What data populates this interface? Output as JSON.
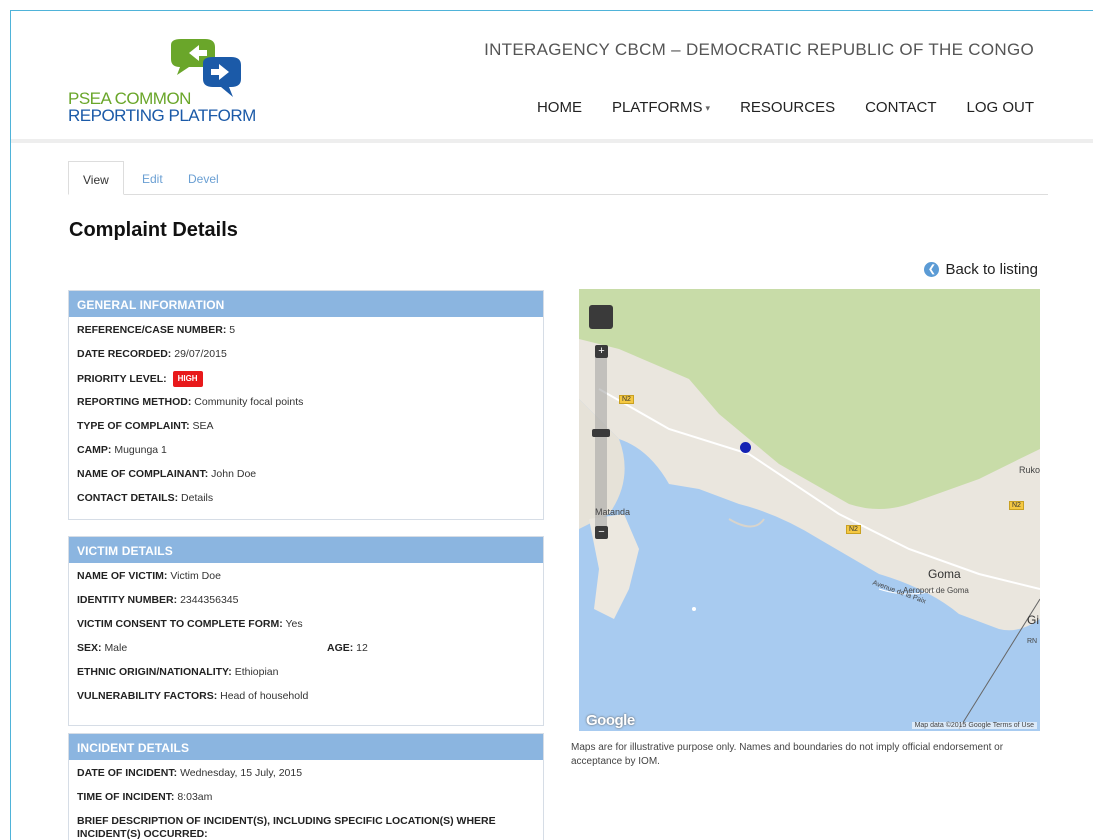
{
  "logo": {
    "line1": "PSEA COMMON",
    "line2": "REPORTING PLATFORM"
  },
  "site_title": "INTERAGENCY CBCM – DEMOCRATIC REPUBLIC OF THE CONGO",
  "nav": {
    "home": "HOME",
    "platforms": "PLATFORMS",
    "resources": "RESOURCES",
    "contact": "CONTACT",
    "logout": "LOG OUT"
  },
  "tabs": {
    "view": "View",
    "edit": "Edit",
    "devel": "Devel"
  },
  "page_title": "Complaint Details",
  "back_link": "Back to listing",
  "general": {
    "title": "GENERAL INFORMATION",
    "rows": [
      {
        "label": "REFERENCE/CASE NUMBER:",
        "value": "5"
      },
      {
        "label": "DATE RECORDED:",
        "value": "29/07/2015"
      },
      {
        "label": "PRIORITY LEVEL:",
        "value": "HIGH"
      },
      {
        "label": "REPORTING METHOD:",
        "value": "Community focal points"
      },
      {
        "label": "TYPE OF COMPLAINT:",
        "value": "SEA"
      },
      {
        "label": "CAMP:",
        "value": "Mugunga 1"
      },
      {
        "label": "NAME OF COMPLAINANT:",
        "value": "John Doe"
      },
      {
        "label": "CONTACT DETAILS:",
        "value": "Details"
      }
    ]
  },
  "victim": {
    "title": "VICTIM DETAILS",
    "rows": [
      {
        "label": "NAME OF VICTIM:",
        "value": "Victim Doe"
      },
      {
        "label": "IDENTITY NUMBER:",
        "value": "2344356345"
      },
      {
        "label": "VICTIM CONSENT TO COMPLETE FORM:",
        "value": "Yes"
      },
      {
        "label": "SEX:",
        "value": "Male"
      },
      {
        "label": "ETHNIC ORIGIN/NATIONALITY:",
        "value": "Ethiopian"
      },
      {
        "label": "VULNERABILITY FACTORS:",
        "value": "Head of household"
      }
    ],
    "age_label": "AGE:",
    "age_value": "12"
  },
  "incident": {
    "title": "INCIDENT DETAILS",
    "rows": [
      {
        "label": "DATE OF INCIDENT:",
        "value": "Wednesday, 15 July, 2015"
      },
      {
        "label": "TIME OF INCIDENT:",
        "value": "8:03am"
      },
      {
        "label": "BRIEF DESCRIPTION OF INCIDENT(S), INCLUDING SPECIFIC LOCATION(S) WHERE",
        "value": ""
      },
      {
        "label": "INCIDENT(S) OCCURRED:",
        "value": ""
      }
    ]
  },
  "map": {
    "labels": {
      "goma": "Goma",
      "airport": "Aeroport de Goma",
      "avenue": "Avenue de la Paix",
      "matanda": "Matanda",
      "ruko": "Ruko",
      "gi": "Gi",
      "rn": "RN"
    },
    "roads": {
      "n2a": "N2",
      "n2b": "N2",
      "n2c": "N2"
    },
    "brand": "Google",
    "footer": "Map data ©2015 Google   Terms of Use",
    "zoom_in": "+",
    "zoom_out": "−",
    "colors": {
      "land": "#eae6de",
      "park": "#c8dca8",
      "water": "#a8cbf0",
      "marker": "#1522b3"
    }
  },
  "disclaimer": "Maps are for illustrative purpose only. Names and boundaries do not imply official endorsement or acceptance by IOM."
}
